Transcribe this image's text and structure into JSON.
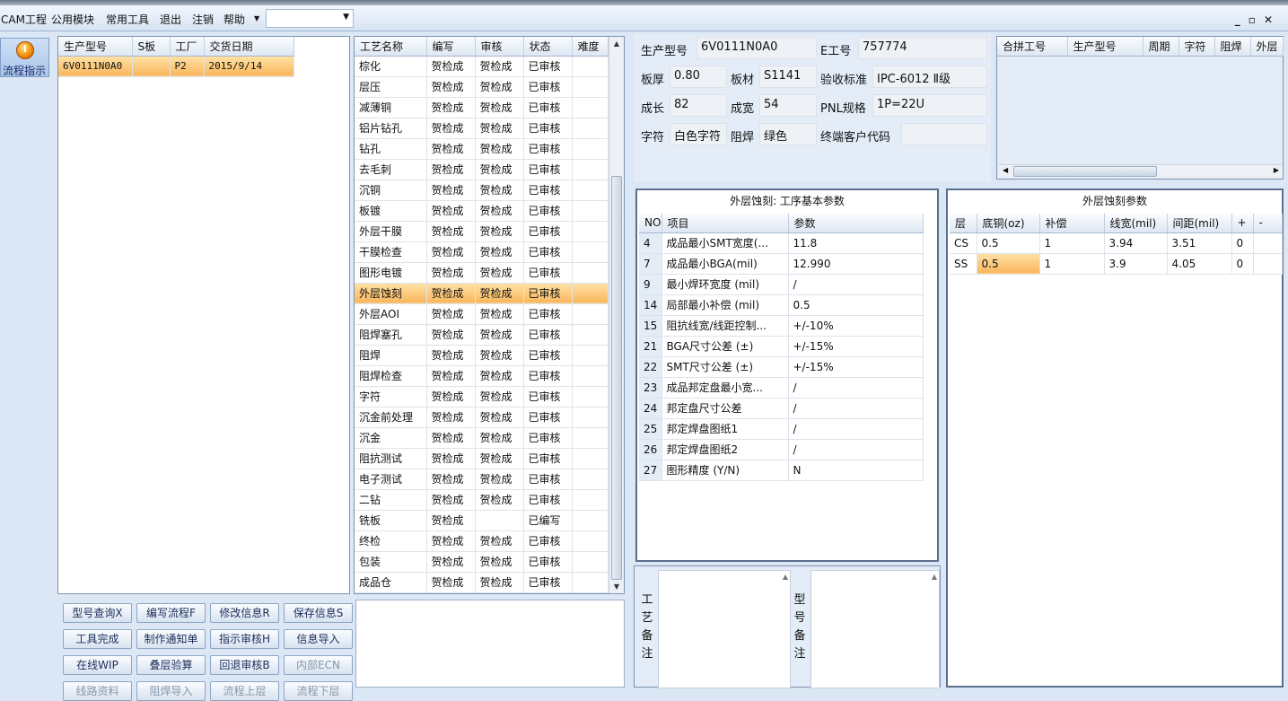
{
  "menu": {
    "items": [
      "CAM工程",
      "公用模块",
      "常用工具",
      "退出",
      "注销",
      "帮助"
    ],
    "combo_value": ""
  },
  "nav": {
    "flow_label": "流程指示"
  },
  "model_list": {
    "headers": [
      "生产型号",
      "S板",
      "工厂",
      "交货日期"
    ],
    "rows": [
      [
        "6V0111N0A0",
        "",
        "P2",
        "2015/9/14"
      ]
    ]
  },
  "process_list": {
    "headers": [
      "工艺名称",
      "编写",
      "审核",
      "状态",
      "难度"
    ],
    "rows": [
      [
        "棕化",
        "贺检成",
        "贺检成",
        "已审核",
        ""
      ],
      [
        "层压",
        "贺检成",
        "贺检成",
        "已审核",
        ""
      ],
      [
        "减薄铜",
        "贺检成",
        "贺检成",
        "已审核",
        ""
      ],
      [
        "铝片钻孔",
        "贺检成",
        "贺检成",
        "已审核",
        ""
      ],
      [
        "钻孔",
        "贺检成",
        "贺检成",
        "已审核",
        ""
      ],
      [
        "去毛刺",
        "贺检成",
        "贺检成",
        "已审核",
        ""
      ],
      [
        "沉铜",
        "贺检成",
        "贺检成",
        "已审核",
        ""
      ],
      [
        "板镀",
        "贺检成",
        "贺检成",
        "已审核",
        ""
      ],
      [
        "外层干膜",
        "贺检成",
        "贺检成",
        "已审核",
        ""
      ],
      [
        "干膜检查",
        "贺检成",
        "贺检成",
        "已审核",
        ""
      ],
      [
        "图形电镀",
        "贺检成",
        "贺检成",
        "已审核",
        ""
      ],
      [
        "外层蚀刻",
        "贺检成",
        "贺检成",
        "已审核",
        ""
      ],
      [
        "外层AOI",
        "贺检成",
        "贺检成",
        "已审核",
        ""
      ],
      [
        "阻焊塞孔",
        "贺检成",
        "贺检成",
        "已审核",
        ""
      ],
      [
        "阻焊",
        "贺检成",
        "贺检成",
        "已审核",
        ""
      ],
      [
        "阻焊检查",
        "贺检成",
        "贺检成",
        "已审核",
        ""
      ],
      [
        "字符",
        "贺检成",
        "贺检成",
        "已审核",
        ""
      ],
      [
        "沉金前处理",
        "贺检成",
        "贺检成",
        "已审核",
        ""
      ],
      [
        "沉金",
        "贺检成",
        "贺检成",
        "已审核",
        ""
      ],
      [
        "阻抗测试",
        "贺检成",
        "贺检成",
        "已审核",
        ""
      ],
      [
        "电子测试",
        "贺检成",
        "贺检成",
        "已审核",
        ""
      ],
      [
        "二钻",
        "贺检成",
        "贺检成",
        "已审核",
        ""
      ],
      [
        "铣板",
        "贺检成",
        "",
        "已编写",
        ""
      ],
      [
        "终检",
        "贺检成",
        "贺检成",
        "已审核",
        ""
      ],
      [
        "包装",
        "贺检成",
        "贺检成",
        "已审核",
        ""
      ],
      [
        "成品仓",
        "贺检成",
        "贺检成",
        "已审核",
        ""
      ]
    ],
    "selected_index": 11
  },
  "info": {
    "model_label": "生产型号",
    "model_value": "6V0111N0A0",
    "e_label": "E工号",
    "e_value": "757774",
    "thick_label": "板厚",
    "thick_value": "0.80",
    "material_label": "板材",
    "material_value": "S1141",
    "std_label": "验收标准",
    "std_value": "IPC-6012 Ⅱ级",
    "len_label": "成长",
    "len_value": "82",
    "width_label": "成宽",
    "width_value": "54",
    "pnl_label": "PNL规格",
    "pnl_value": "1P=22U",
    "char_label": "字符",
    "char_value": "白色字符",
    "mask_label": "阻焊",
    "mask_value": "绿色",
    "cust_label": "终端客户代码",
    "cust_value": ""
  },
  "combine_table": {
    "headers": [
      "合拼工号",
      "生产型号",
      "周期",
      "字符",
      "阻焊",
      "外层"
    ]
  },
  "basic_params": {
    "title": "外层蚀刻: 工序基本参数",
    "headers": [
      "NO",
      "项目",
      "参数"
    ],
    "rows": [
      [
        "4",
        "成品最小SMT宽度(...",
        "11.8"
      ],
      [
        "7",
        "成品最小BGA(mil)",
        "12.990"
      ],
      [
        "9",
        "最小焊环宽度 (mil)",
        "/"
      ],
      [
        "14",
        "局部最小补偿 (mil)",
        "0.5"
      ],
      [
        "15",
        "阻抗线宽/线距控制...",
        "+/-10%"
      ],
      [
        "21",
        "BGA尺寸公差 (±)",
        "+/-15%"
      ],
      [
        "22",
        "SMT尺寸公差 (±)",
        "+/-15%"
      ],
      [
        "23",
        "成品邦定盘最小宽...",
        "/"
      ],
      [
        "24",
        "邦定盘尺寸公差",
        "/"
      ],
      [
        "25",
        "邦定焊盘图纸1",
        "/"
      ],
      [
        "26",
        "邦定焊盘图纸2",
        "/"
      ],
      [
        "27",
        "图形精度 (Y/N)",
        "N"
      ]
    ]
  },
  "etch_params": {
    "title": "外层蚀刻参数",
    "headers": [
      "层",
      "底铜(oz)",
      "补偿",
      "线宽(mil)",
      "间距(mil)",
      "+",
      "-"
    ],
    "rows": [
      [
        "CS",
        "0.5",
        "1",
        "3.94",
        "3.51",
        "0",
        ""
      ],
      [
        "SS",
        "0.5",
        "1",
        "3.9",
        "4.05",
        "0",
        ""
      ]
    ]
  },
  "notes": {
    "process_note_label": "工艺备注",
    "model_note_label": "型号备注"
  },
  "buttons": [
    [
      "型号查询X",
      "编写流程F",
      "修改信息R",
      "保存信息S"
    ],
    [
      "工具完成",
      "制作通知单",
      "指示审核H",
      "信息导入"
    ],
    [
      "在线WIP",
      "叠层验算",
      "回退审核B",
      "内部ECN"
    ],
    [
      "线路资料",
      "阻焊导入",
      "流程上层",
      "流程下层"
    ]
  ]
}
